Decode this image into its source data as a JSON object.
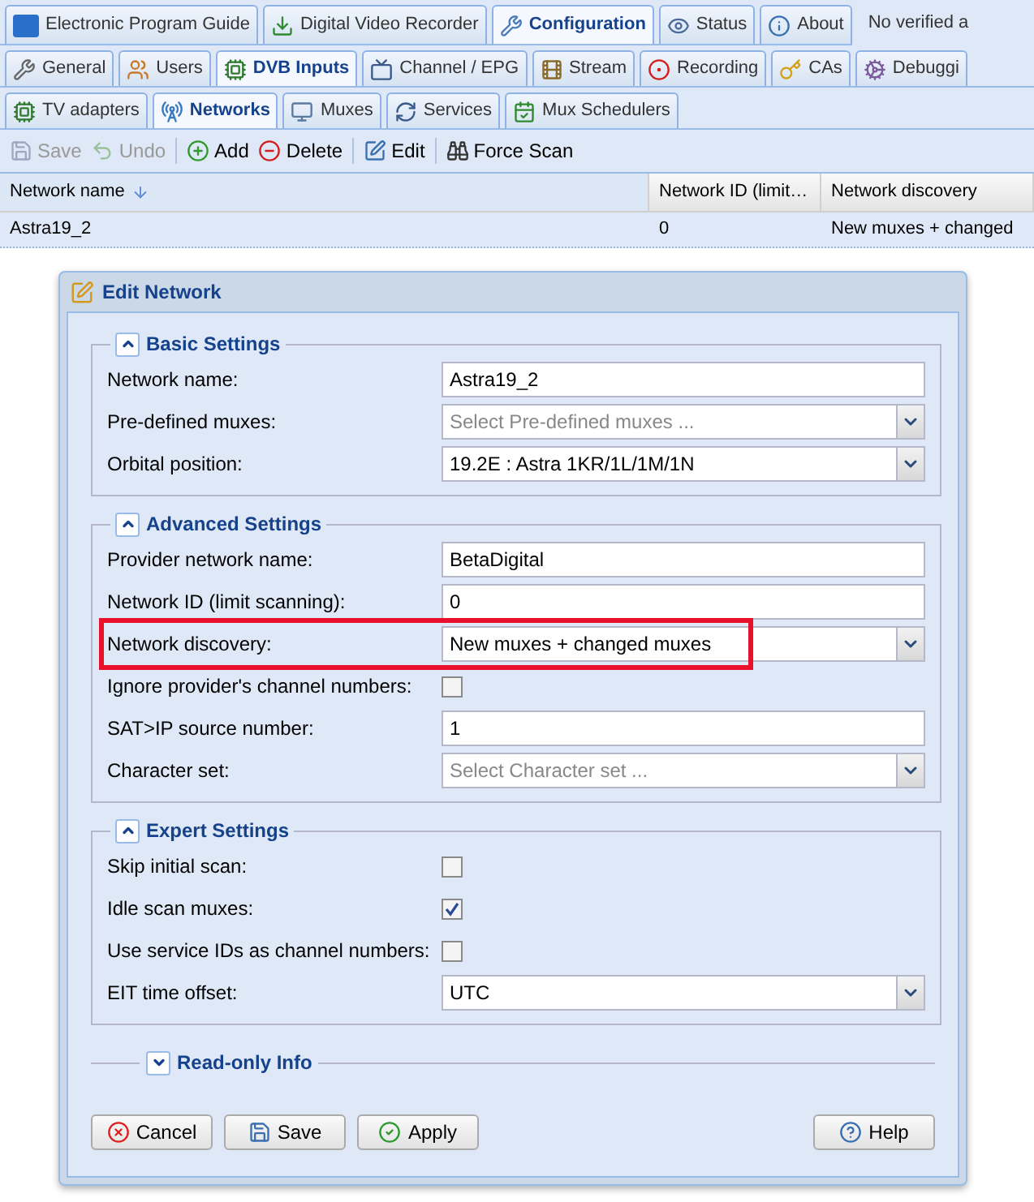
{
  "main_tabs": [
    {
      "label": "Electronic Program Guide",
      "selected": false
    },
    {
      "label": "Digital Video Recorder",
      "selected": false
    },
    {
      "label": "Configuration",
      "selected": true
    },
    {
      "label": "Status",
      "selected": false
    },
    {
      "label": "About",
      "selected": false
    }
  ],
  "status_text": "No verified a",
  "sub_tabs": [
    {
      "label": "General",
      "selected": false
    },
    {
      "label": "Users",
      "selected": false
    },
    {
      "label": "DVB Inputs",
      "selected": true
    },
    {
      "label": "Channel / EPG",
      "selected": false
    },
    {
      "label": "Stream",
      "selected": false
    },
    {
      "label": "Recording",
      "selected": false
    },
    {
      "label": "CAs",
      "selected": false
    },
    {
      "label": "Debuggi",
      "selected": false
    }
  ],
  "inner_tabs": [
    {
      "label": "TV adapters",
      "selected": false
    },
    {
      "label": "Networks",
      "selected": true
    },
    {
      "label": "Muxes",
      "selected": false
    },
    {
      "label": "Services",
      "selected": false
    },
    {
      "label": "Mux Schedulers",
      "selected": false
    }
  ],
  "toolbar": [
    {
      "label": "Save",
      "disabled": true
    },
    {
      "label": "Undo",
      "disabled": true
    },
    {
      "label": "Add",
      "disabled": false
    },
    {
      "label": "Delete",
      "disabled": false
    },
    {
      "label": "Edit",
      "disabled": false
    },
    {
      "label": "Force Scan",
      "disabled": false
    }
  ],
  "table": {
    "columns": [
      {
        "label": "Network name",
        "sorted": true
      },
      {
        "label": "Network ID (limit…",
        "sorted": false
      },
      {
        "label": "Network discovery",
        "sorted": false
      }
    ],
    "rows": [
      {
        "cells": [
          "Astra19_2",
          "0",
          "New muxes + changed"
        ],
        "selected": true
      }
    ]
  },
  "dialog": {
    "title": "Edit Network",
    "sections": [
      {
        "title": "Basic Settings",
        "expanded": true,
        "fields": [
          {
            "kind": "text",
            "label": "Network name:",
            "value": "Astra19_2",
            "highlighted": false
          },
          {
            "kind": "combo",
            "label": "Pre-defined muxes:",
            "placeholder": "Select Pre-defined muxes ...",
            "highlighted": false
          },
          {
            "kind": "combo",
            "label": "Orbital position:",
            "value": "19.2E : Astra 1KR/1L/1M/1N",
            "highlighted": false
          }
        ]
      },
      {
        "title": "Advanced Settings",
        "expanded": true,
        "fields": [
          {
            "kind": "text",
            "label": "Provider network name:",
            "value": "BetaDigital",
            "highlighted": false
          },
          {
            "kind": "text",
            "label": "Network ID (limit scanning):",
            "value": "0",
            "highlighted": false
          },
          {
            "kind": "combo",
            "label": "Network discovery:",
            "value": "New muxes + changed muxes",
            "highlighted": true
          },
          {
            "kind": "checkbox",
            "label": "Ignore provider's channel numbers:",
            "checked": false,
            "highlighted": false
          },
          {
            "kind": "text",
            "label": "SAT>IP source number:",
            "value": "1",
            "highlighted": false
          },
          {
            "kind": "combo",
            "label": "Character set:",
            "placeholder": "Select Character set ...",
            "highlighted": false
          }
        ]
      },
      {
        "title": "Expert Settings",
        "expanded": true,
        "fields": [
          {
            "kind": "checkbox",
            "label": "Skip initial scan:",
            "checked": false,
            "highlighted": false
          },
          {
            "kind": "checkbox",
            "label": "Idle scan muxes:",
            "checked": true,
            "highlighted": false
          },
          {
            "kind": "checkbox",
            "label": "Use service IDs as channel numbers:",
            "checked": false,
            "highlighted": false
          },
          {
            "kind": "combo",
            "label": "EIT time offset:",
            "value": "UTC",
            "highlighted": false
          }
        ]
      },
      {
        "title": "Read-only Info",
        "expanded": false
      }
    ],
    "buttons": [
      {
        "label": "Cancel",
        "kind": "cancel"
      },
      {
        "label": "Save",
        "kind": "save"
      },
      {
        "label": "Apply",
        "kind": "apply"
      },
      {
        "label": "Help",
        "kind": "help"
      }
    ]
  }
}
